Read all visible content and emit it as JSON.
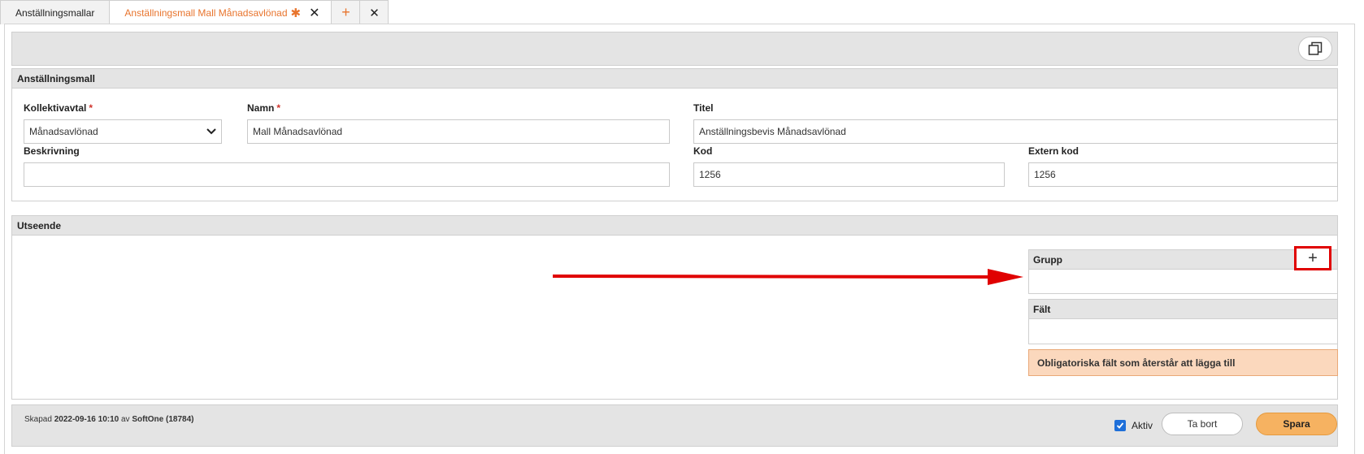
{
  "tabs": [
    {
      "label": "Anställningsmallar"
    },
    {
      "label": "Anställningsmall Mall Månadsavlönad",
      "modified": "✱"
    }
  ],
  "template_panel": {
    "title": "Anställningsmall",
    "collective_agreement": {
      "label": "Kollektivavtal",
      "required": "*",
      "value": "Månadsavlönad"
    },
    "name": {
      "label": "Namn",
      "required": "*",
      "value": "Mall Månadsavlönad"
    },
    "title_field": {
      "label": "Titel",
      "value": "Anställningsbevis Månadsavlönad"
    },
    "description": {
      "label": "Beskrivning",
      "value": ""
    },
    "code": {
      "label": "Kod",
      "value": "1256"
    },
    "external_code": {
      "label": "Extern kod",
      "value": "1256"
    }
  },
  "appearance_panel": {
    "title": "Utseende",
    "group_header": "Grupp",
    "field_header": "Fält",
    "warning": "Obligatoriska fält som återstår att lägga till"
  },
  "footer": {
    "created_prefix": "Skapad",
    "created_date": "2022-09-16 10:10",
    "by": "av",
    "created_by": "SoftOne (18784)",
    "active_label": "Aktiv",
    "active_checked": true,
    "delete_label": "Ta bort",
    "save_label": "Spara"
  },
  "colors": {
    "accent": "#e8742d",
    "save": "#f6b261",
    "highlight": "#e00000",
    "warning_bg": "#fbd8bd"
  }
}
